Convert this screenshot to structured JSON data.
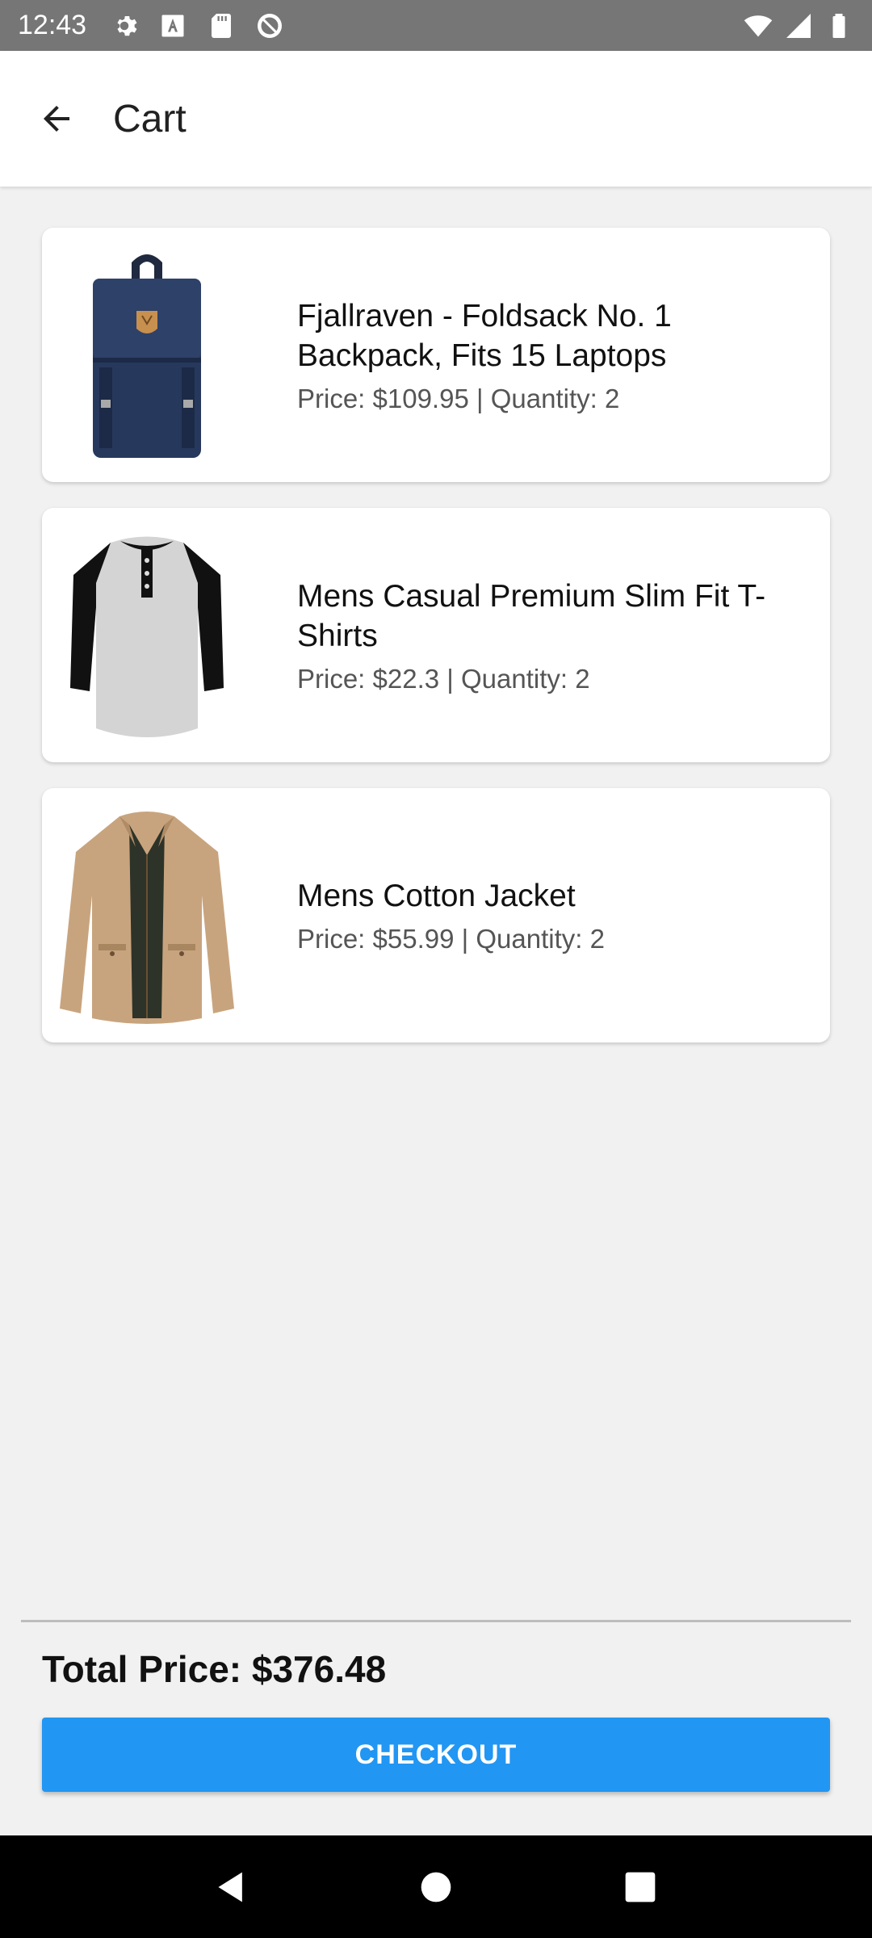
{
  "status_bar": {
    "time": "12:43",
    "left_icons": [
      "gear-icon",
      "text-a-icon",
      "sd-card-icon",
      "no-sync-icon"
    ],
    "right_icons": [
      "wifi-icon",
      "signal-icon",
      "battery-icon"
    ]
  },
  "app_bar": {
    "title": "Cart",
    "back_icon": "arrow-left-icon"
  },
  "cart": {
    "items": [
      {
        "title": "Fjallraven - Foldsack No. 1 Backpack, Fits 15 Laptops",
        "detail": "Price: $109.95 | Quantity: 2",
        "image": "backpack"
      },
      {
        "title": "Mens Casual Premium Slim Fit T-Shirts",
        "detail": "Price: $22.3 | Quantity: 2",
        "image": "t-shirt"
      },
      {
        "title": "Mens Cotton Jacket",
        "detail": "Price: $55.99 | Quantity: 2",
        "image": "jacket"
      }
    ]
  },
  "footer": {
    "total_label": "Total Price: $376.48",
    "checkout_label": "CHECKOUT"
  },
  "colors": {
    "accent": "#2196f3",
    "status_bar": "#767676",
    "background": "#f1f1f1"
  },
  "nav_bar": {
    "icons": [
      "back-triangle-icon",
      "home-circle-icon",
      "recents-square-icon"
    ]
  }
}
